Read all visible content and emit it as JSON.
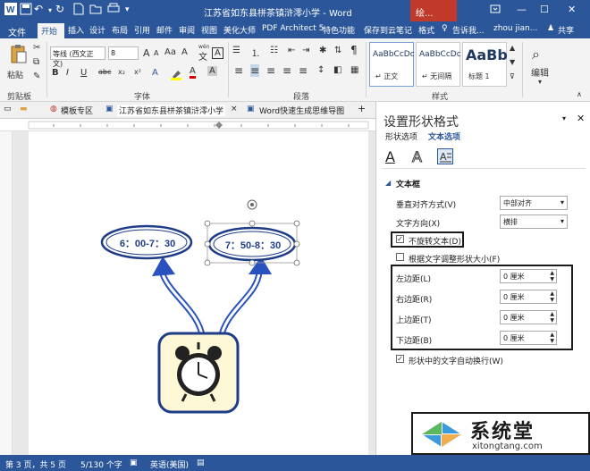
{
  "titlebar": {
    "title": "江苏省如东县栟茶镇浒澪小学 - Word",
    "context_tab": "绘...",
    "icons": [
      "word-logo-icon",
      "save-icon",
      "undo-icon",
      "redo-icon",
      "new-doc-icon",
      "open-icon",
      "print-icon",
      "customize-icon"
    ],
    "window_controls": [
      "restore-ribbon-icon",
      "minimize-icon",
      "maximize-icon",
      "close-icon"
    ]
  },
  "ribbon_tabs": {
    "file": "文件",
    "items": [
      "开始",
      "插入",
      "设计",
      "布局",
      "引用",
      "邮件",
      "审阅",
      "视图",
      "美化大师",
      "PDF Architect 5",
      "特色功能",
      "保存到云笔记",
      "格式"
    ],
    "tell": "告诉我...",
    "user": "zhou jian...",
    "share": "共享"
  },
  "ribbon": {
    "paste": "粘贴",
    "clipboard_label": "剪贴板",
    "font_name": "等线 (西文正文)",
    "font_size": "8",
    "font_label": "字体",
    "paragraph_label": "段落",
    "styles_label": "样式",
    "editing": "编辑",
    "styles": [
      {
        "sample": "AaBbCcDc",
        "name": "↵ 正文"
      },
      {
        "sample": "AaBbCcDc",
        "name": "↵ 无间隔"
      },
      {
        "sample": "AaBb",
        "name": "标题 1"
      }
    ],
    "font_buttons": [
      "B",
      "I",
      "U",
      "abc",
      "x₂",
      "x²"
    ],
    "big_a": "A",
    "small_a": "A",
    "wen": "wén",
    "wen_char": "文",
    "aa": "Aa",
    "a_box": "A",
    "a_ring": "A",
    "cross_a": "A",
    "para_marks": [
      "≡",
      "≡",
      "≡",
      "≡",
      "≡"
    ]
  },
  "doc_tabs": {
    "items": [
      "模板专区",
      "江苏省如东县栟茶镇浒澪小学",
      "Word快速生成思维导图"
    ],
    "close": "×",
    "add": "+"
  },
  "diagram": {
    "left_oval": "6：00-7：30",
    "right_oval": "7：50-8：30"
  },
  "pane": {
    "title": "设置形状格式",
    "tabs": [
      "形状选项",
      "文本选项"
    ],
    "section": "文本框",
    "rows": [
      {
        "label": "垂直对齐方式(V)",
        "value": "中部对齐"
      },
      {
        "label": "文字方向(X)",
        "value": "横排"
      }
    ],
    "no_rotate": "不旋转文本(D)",
    "autofit": "根据文字调整形状大小(F)",
    "margins": [
      {
        "label": "左边距(L)",
        "value": "0 厘米"
      },
      {
        "label": "右边距(R)",
        "value": "0 厘米"
      },
      {
        "label": "上边距(T)",
        "value": "0 厘米"
      },
      {
        "label": "下边距(B)",
        "value": "0 厘米"
      }
    ],
    "wrap": "形状中的文字自动换行(W)"
  },
  "status": {
    "page": "第 3 页，共 5 页",
    "words": "5/130 个字",
    "lang": "英语(美国)"
  },
  "watermark": {
    "brand": "系统堂",
    "url": "xitongtang.com"
  },
  "colors": {
    "accent": "#2b579a",
    "diagram_blue": "#2a52be",
    "clock_frame": "#1f3c88",
    "clock_bg": "#fff8d6",
    "highlight_box": "#1a1a1a"
  }
}
